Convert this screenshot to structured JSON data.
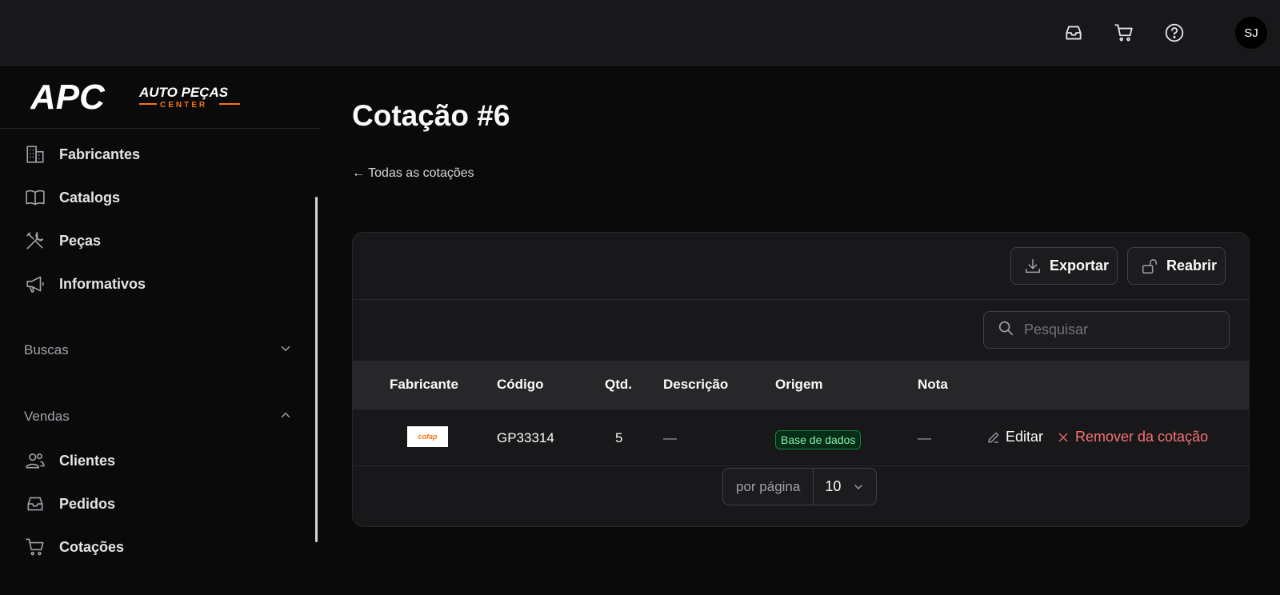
{
  "header": {
    "avatar_initials": "SJ"
  },
  "brand": {
    "logo_mark": "APC",
    "logo_line1": "AUTO PEÇAS",
    "logo_line2": "CENTER"
  },
  "sidebar": {
    "items": [
      {
        "label": "Fabricantes",
        "icon": "building-icon"
      },
      {
        "label": "Catalogs",
        "icon": "book-icon"
      },
      {
        "label": "Peças",
        "icon": "wrench-icon"
      },
      {
        "label": "Informativos",
        "icon": "megaphone-icon"
      }
    ],
    "sections": [
      {
        "label": "Buscas",
        "expanded": false
      },
      {
        "label": "Vendas",
        "expanded": true
      }
    ],
    "vendas_items": [
      {
        "label": "Clientes",
        "icon": "users-icon"
      },
      {
        "label": "Pedidos",
        "icon": "inbox-icon"
      },
      {
        "label": "Cotações",
        "icon": "cart-icon"
      }
    ]
  },
  "page": {
    "title": "Cotação #6",
    "back_link": "← Todas as cotações"
  },
  "toolbar": {
    "export_label": "Exportar",
    "reopen_label": "Reabrir"
  },
  "search": {
    "placeholder": "Pesquisar"
  },
  "table": {
    "columns": [
      "Fabricante",
      "Código",
      "Qtd.",
      "Descrição",
      "Origem",
      "Nota"
    ],
    "rows": [
      {
        "manufacturer_logo_text": "cofap",
        "code": "GP33314",
        "qty": "5",
        "description": "—",
        "origin": "Base de dados",
        "note": "—",
        "edit_label": "Editar",
        "remove_label": "Remover da cotação"
      }
    ]
  },
  "pagination": {
    "per_page_label": "por página",
    "per_page_value": "10"
  },
  "colors": {
    "background": "#0a0a0b",
    "surface": "#18181b",
    "accent_orange": "#f97316",
    "danger": "#f87171",
    "success_badge_text": "#86efac"
  }
}
